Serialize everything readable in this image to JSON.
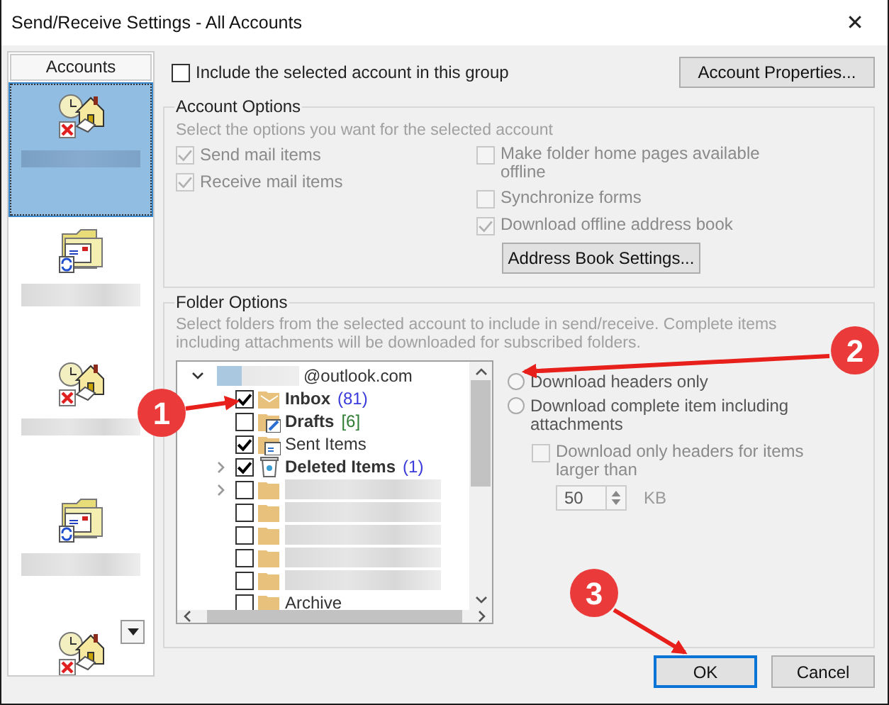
{
  "window": {
    "title": "Send/Receive Settings - All Accounts",
    "close": "✕"
  },
  "accounts": {
    "header": "Accounts",
    "items": [
      {
        "kind": "house",
        "selected": true
      },
      {
        "kind": "folder",
        "selected": false
      },
      {
        "kind": "house",
        "selected": false
      },
      {
        "kind": "folder",
        "selected": false
      },
      {
        "kind": "house",
        "selected": false
      }
    ]
  },
  "include": {
    "label": "Include the selected account in this group",
    "checked": false
  },
  "account_properties_button": "Account Properties...",
  "account_options": {
    "title": "Account Options",
    "description": "Select the options you want for the selected account",
    "left_options": [
      {
        "label": "Send mail items",
        "checked": true
      },
      {
        "label": "Receive mail items",
        "checked": true
      }
    ],
    "right_options": [
      {
        "label": "Make folder home pages available offline",
        "checked": false
      },
      {
        "label": "Synchronize forms",
        "checked": false
      },
      {
        "label": "Download offline address book",
        "checked": true
      }
    ],
    "address_book_button": "Address Book Settings..."
  },
  "folder_options": {
    "title": "Folder Options",
    "description": "Select folders from the selected account to include in send/receive. Complete items including attachments will be downloaded for subscribed folders.",
    "account": {
      "text": "@outlook.com",
      "expanded": true
    },
    "folders": [
      {
        "kind": "inbox",
        "name": "Inbox",
        "count": "(81)",
        "color": "#3b3bdc",
        "bold": true,
        "checked": true,
        "expandable": false
      },
      {
        "kind": "drafts",
        "name": "Drafts",
        "count": "[6]",
        "color": "#2e7d32",
        "bold": true,
        "checked": false,
        "expandable": false
      },
      {
        "kind": "sent",
        "name": "Sent Items",
        "bold": false,
        "checked": true,
        "expandable": false
      },
      {
        "kind": "trash",
        "name": "Deleted Items",
        "count": "(1)",
        "color": "#3b3bdc",
        "bold": true,
        "checked": true,
        "expandable": true
      },
      {
        "kind": "redacted",
        "checked": false,
        "expandable": true
      },
      {
        "kind": "redacted",
        "checked": false,
        "expandable": false
      },
      {
        "kind": "redacted",
        "checked": false,
        "expandable": false
      },
      {
        "kind": "redacted",
        "checked": false,
        "expandable": false
      },
      {
        "kind": "redacted",
        "checked": false,
        "expandable": false
      },
      {
        "kind": "folder",
        "name": "Archive",
        "bold": false,
        "checked": false,
        "expandable": false
      }
    ],
    "download_modes": [
      {
        "label": "Download headers only",
        "selected": false
      },
      {
        "label": "Download complete item including attachments",
        "selected": false
      }
    ],
    "size_limit": {
      "label": "Download only headers for items larger than",
      "checked": false,
      "value": "50",
      "unit": "KB"
    }
  },
  "buttons": [
    {
      "label": "OK",
      "default": true
    },
    {
      "label": "Cancel",
      "default": false
    }
  ],
  "callouts": [
    {
      "label": "1"
    },
    {
      "label": "2"
    },
    {
      "label": "3"
    }
  ]
}
